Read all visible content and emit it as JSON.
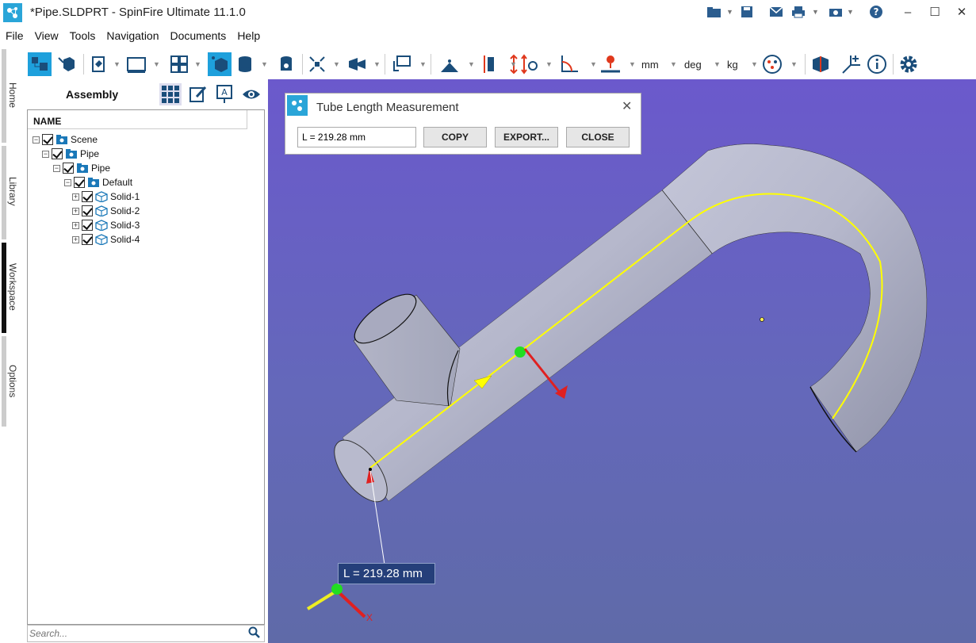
{
  "window": {
    "title": "*Pipe.SLDPRT - SpinFire Ultimate 11.1.0"
  },
  "menu": {
    "items": [
      "File",
      "View",
      "Tools",
      "Navigation",
      "Documents",
      "Help"
    ]
  },
  "toolbar": {
    "units": {
      "length": "mm",
      "angle": "deg",
      "mass": "kg"
    }
  },
  "side_tabs": [
    {
      "label": "Home"
    },
    {
      "label": "Library"
    },
    {
      "label": "Workspace",
      "active": true
    },
    {
      "label": "Options"
    }
  ],
  "panel": {
    "title": "Assembly",
    "tree_header": "NAME",
    "tree": [
      {
        "label": "Scene",
        "level": 0
      },
      {
        "label": "Pipe",
        "level": 1
      },
      {
        "label": "Pipe",
        "level": 2
      },
      {
        "label": "Default",
        "level": 3
      },
      {
        "label": "Solid-1",
        "level": 4
      },
      {
        "label": "Solid-2",
        "level": 4
      },
      {
        "label": "Solid-3",
        "level": 4
      },
      {
        "label": "Solid-4",
        "level": 4
      }
    ],
    "search_placeholder": "Search..."
  },
  "dialog": {
    "title": "Tube Length Measurement",
    "value": "L = 219.28 mm",
    "copy_label": "COPY",
    "export_label": "EXPORT...",
    "close_label": "CLOSE"
  },
  "viewport": {
    "length_label": "L = 219.28 mm",
    "axis_x_label": "X"
  },
  "colors": {
    "accent": "#1ea0dc",
    "viewport_top": "#6b59cc",
    "measure_line": "#ffff00",
    "label_bg": "#253f7a"
  }
}
